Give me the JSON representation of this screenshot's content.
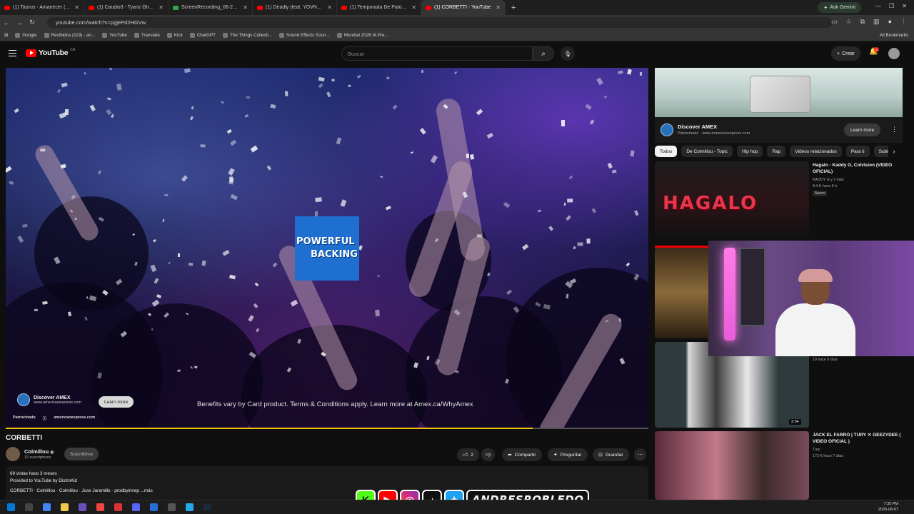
{
  "browser": {
    "tabs": [
      {
        "title": "(1) Taurus - Amanecer (Official",
        "fav": "red"
      },
      {
        "title": "(1) Caudio3 - Tyanz Ghost - You",
        "fav": "red"
      },
      {
        "title": "ScreenRecording_06-24-2026 1",
        "fav": "green"
      },
      {
        "title": "(1) Deadly (feat. YOVNGLIZZY)",
        "fav": "red"
      },
      {
        "title": "(1) Temporada De Patos - Lil G",
        "fav": "red"
      },
      {
        "title": "(1) CORBETTI - YouTube",
        "fav": "red",
        "active": true
      }
    ],
    "new_tab": "+",
    "gemini": "Ask Gemini",
    "url": "youtube.com/watch?v=pgjePd2HGVw",
    "bookmarks": [
      "Google",
      "Recibidos (119) - an...",
      "YouTube",
      "Translate",
      "Kick",
      "ChatGPT",
      "The Things Collecti...",
      "Sound Effects Soun...",
      "Mundial 2026 IA Pre..."
    ],
    "all_bookmarks": "All Bookmarks"
  },
  "yt": {
    "logo": "YouTube",
    "country": "CA",
    "search_placeholder": "Buscar",
    "create": "Crear",
    "notif_count": "1"
  },
  "player": {
    "ad_name": "Discover AMEX",
    "ad_url": "www.americanexpress.com",
    "ad_learn": "Learn more",
    "sponsored": "Patrocinado",
    "sponsored_url": "americanexpress.com",
    "caption": "Benefits vary by Card product. Terms & Conditions apply. Learn more at Amex.ca/WhyAmex",
    "powerful_1": "POWERFUL",
    "powerful_2": "BACKING",
    "progress": 0.82
  },
  "video": {
    "title": "CORBETTI",
    "channel": "Colmillou",
    "subs": "19 suscriptores",
    "subscribe": "Suscribirse",
    "likes": "2",
    "share": "Compartir",
    "ask": "Preguntar",
    "save": "Guardar",
    "desc_views": "69 vistas  hace 3 meses",
    "desc_line2": "Provided to YouTube by DistroKid",
    "desc_line3": "CORBETTI · Colmillou · Colmillou · Jose Jaramillo · prodbyinnep ...más"
  },
  "sidebar": {
    "ad_name": "Discover AMEX",
    "ad_sub": "Patrocinado · www.americanexpress.com",
    "ad_learn": "Learn more",
    "chips": [
      "Todos",
      "De Colmillou - Topic",
      "Hip hop",
      "Rap",
      "Videos relacionados",
      "Para ti",
      "Subido"
    ],
    "videos": [
      {
        "title": "Hagalo - Kaddy G, Colvision (VIDEO OFICIAL)",
        "channel": "KADDY G y 3 más",
        "meta": "8.4 K  hace 6 h",
        "badge": "Nuevo",
        "thumb_text": "HAGALO"
      },
      {
        "meta": "19  hace 6 días",
        "duration": "2:34"
      },
      {
        "title": "JACK EL FARRO | TURY ✕ GEEZYDEE ( VIDEO OFICIAL )",
        "channel": "Tury",
        "meta": "173 K  hace 7 días"
      }
    ]
  },
  "overlay": {
    "name": "ANDRESROBLEDO"
  },
  "taskbar": {
    "time": "7:35 PM",
    "date": "2026-08-07"
  }
}
